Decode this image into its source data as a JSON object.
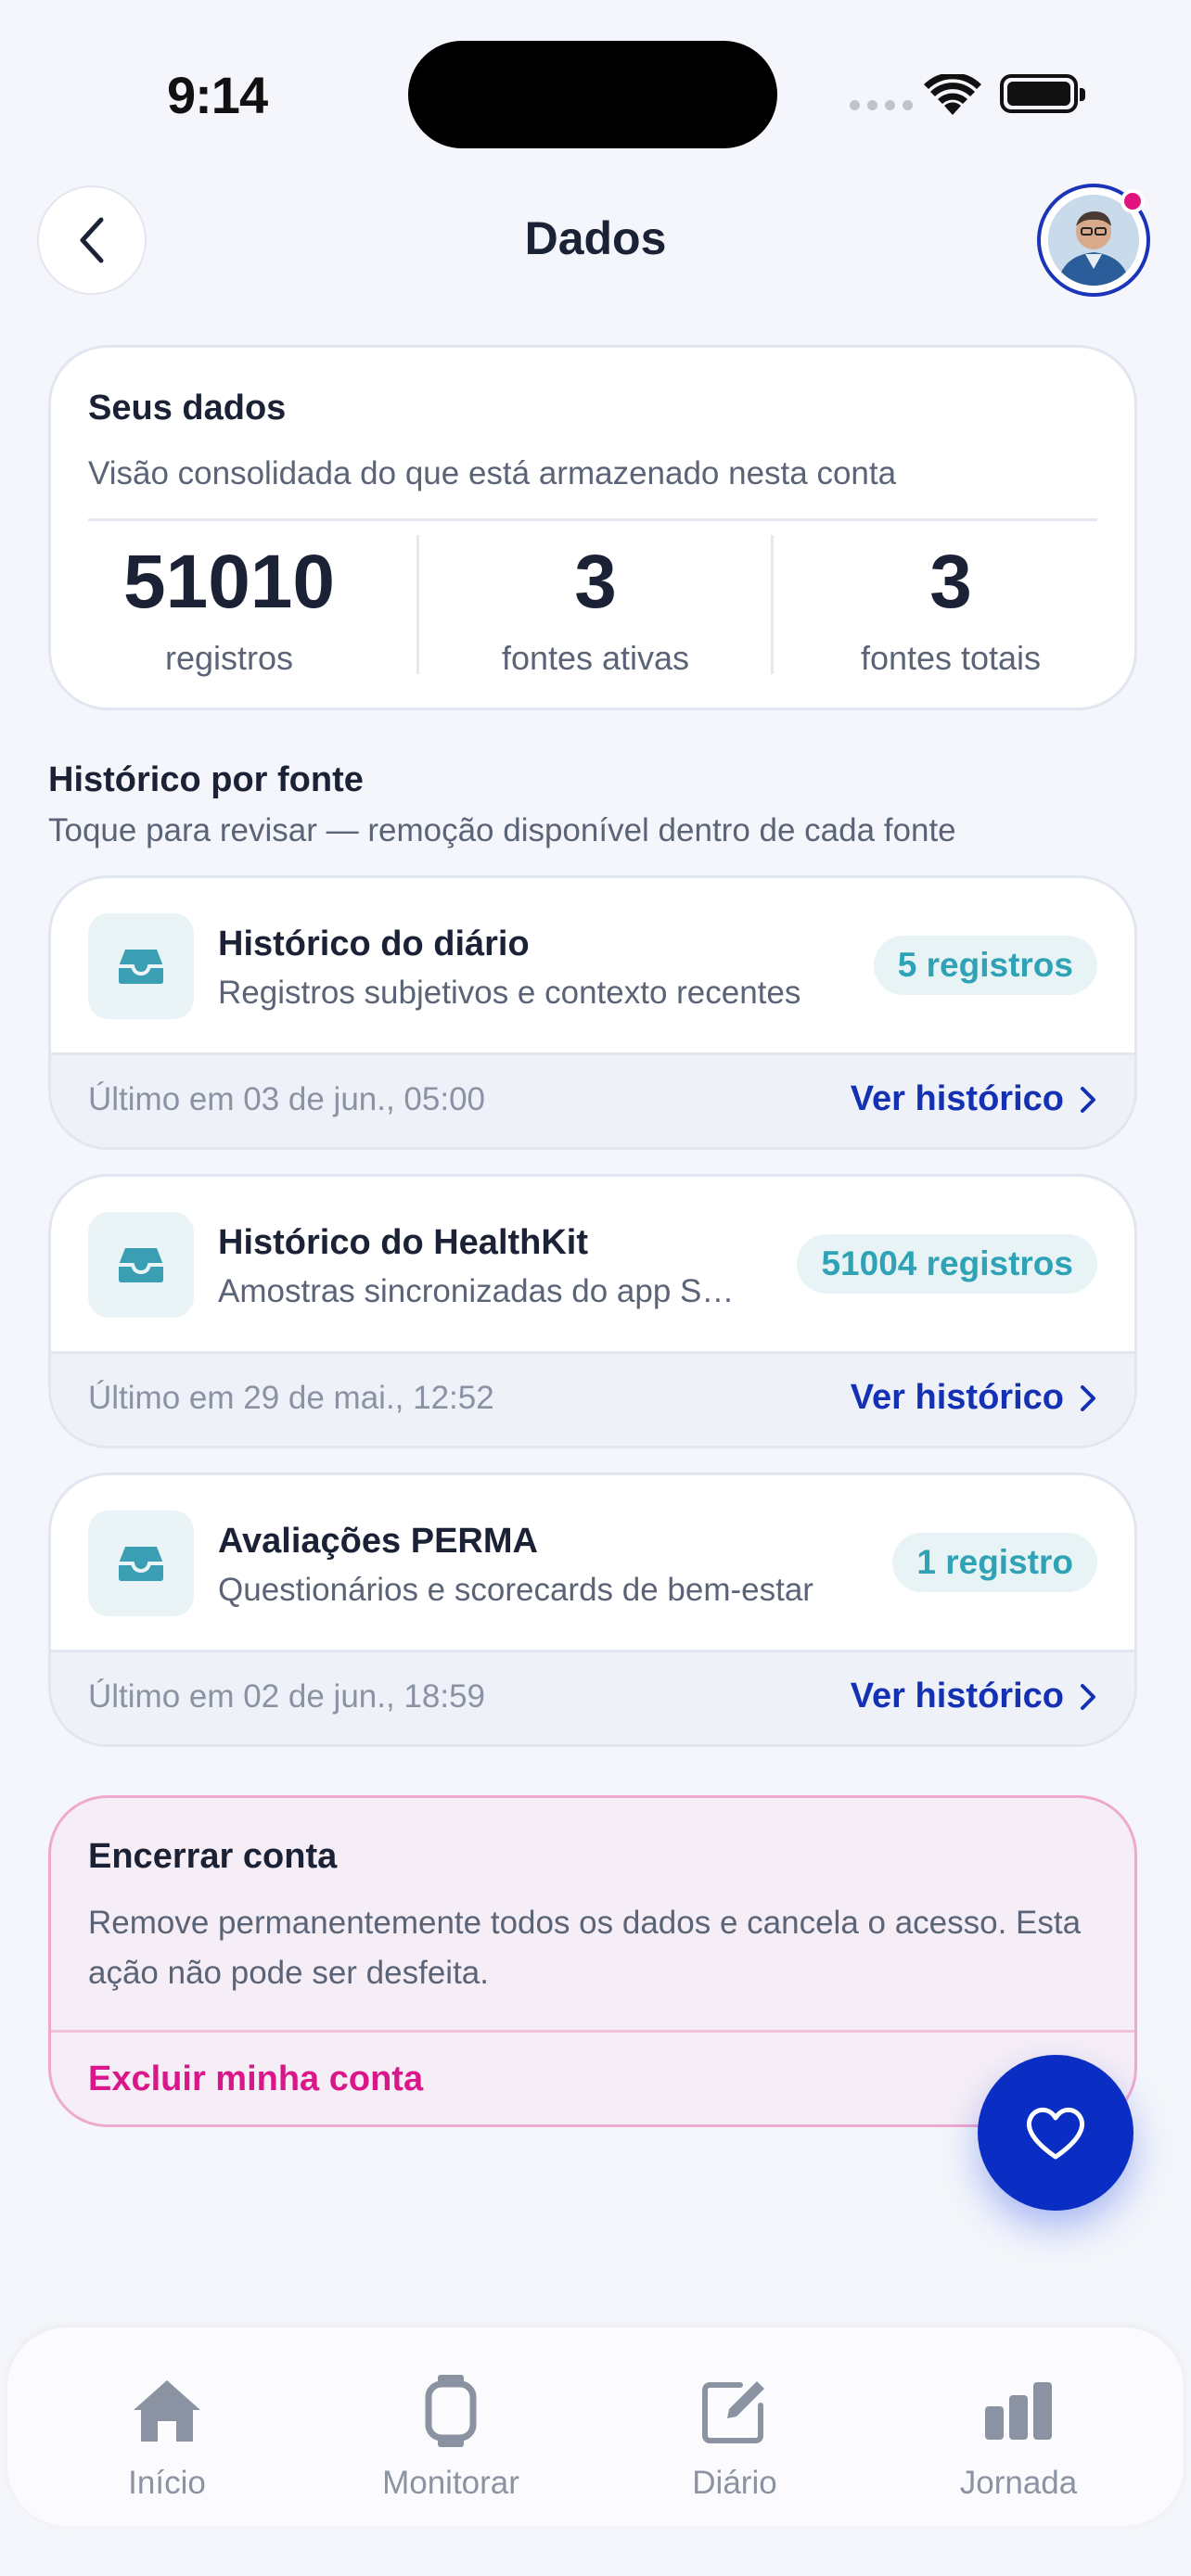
{
  "status_bar": {
    "time": "9:14"
  },
  "header": {
    "title": "Dados"
  },
  "summary": {
    "heading": "Seus dados",
    "subtitle": "Visão consolidada do que está armazenado nesta conta",
    "stats": [
      {
        "value": "51010",
        "label": "registros"
      },
      {
        "value": "3",
        "label": "fontes ativas"
      },
      {
        "value": "3",
        "label": "fontes totais"
      }
    ]
  },
  "history": {
    "title": "Histórico por fonte",
    "subtitle": "Toque para revisar — remoção disponível dentro de cada fonte",
    "view_label": "Ver histórico",
    "sources": [
      {
        "title": "Histórico do diário",
        "description": "Registros subjetivos e contexto recentes",
        "count": "5 registros",
        "last": "Último em 03 de jun., 05:00"
      },
      {
        "title": "Histórico do HealthKit",
        "description": "Amostras sincronizadas do app Saúde",
        "count": "51004 registros",
        "last": "Último em 29 de mai., 12:52"
      },
      {
        "title": "Avaliações PERMA",
        "description": "Questionários e scorecards de bem-estar",
        "count": "1 registro",
        "last": "Último em 02 de jun., 18:59"
      }
    ]
  },
  "account": {
    "heading": "Encerrar conta",
    "body": "Remove permanentemente todos os dados e cancela o acesso. Esta ação não pode ser desfeita.",
    "action": "Excluir minha conta"
  },
  "tabbar": {
    "items": [
      {
        "label": "Início",
        "icon": "home-icon"
      },
      {
        "label": "Monitorar",
        "icon": "watch-icon"
      },
      {
        "label": "Diário",
        "icon": "edit-icon"
      },
      {
        "label": "Jornada",
        "icon": "bar-chart-icon"
      }
    ]
  },
  "colors": {
    "accent": "#1431b3",
    "badge_text": "#2fa2b6",
    "danger": "#d9168a",
    "fab": "#0a2ec3"
  }
}
